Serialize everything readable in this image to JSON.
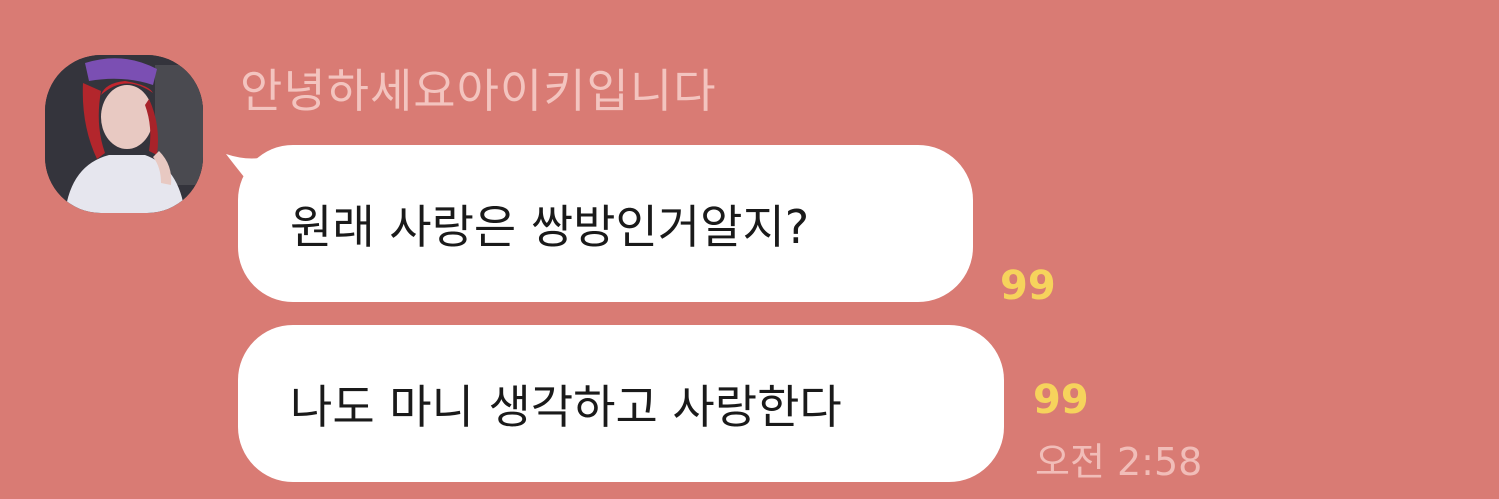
{
  "theme": {
    "background": "#d97b74",
    "bubble": "#ffffff",
    "read_count_color": "#f6d35c",
    "name_color": "#f3c4bf",
    "timestamp_color": "#f1bdb8"
  },
  "sender": {
    "name": "안녕하세요아이키입니다",
    "avatar_icon": "profile-photo"
  },
  "messages": [
    {
      "text": "원래 사랑은 쌍방인거알지?",
      "unread_count": "99"
    },
    {
      "text": "나도 마니 생각하고 사랑한다",
      "unread_count": "99",
      "time": "오전 2:58"
    }
  ]
}
